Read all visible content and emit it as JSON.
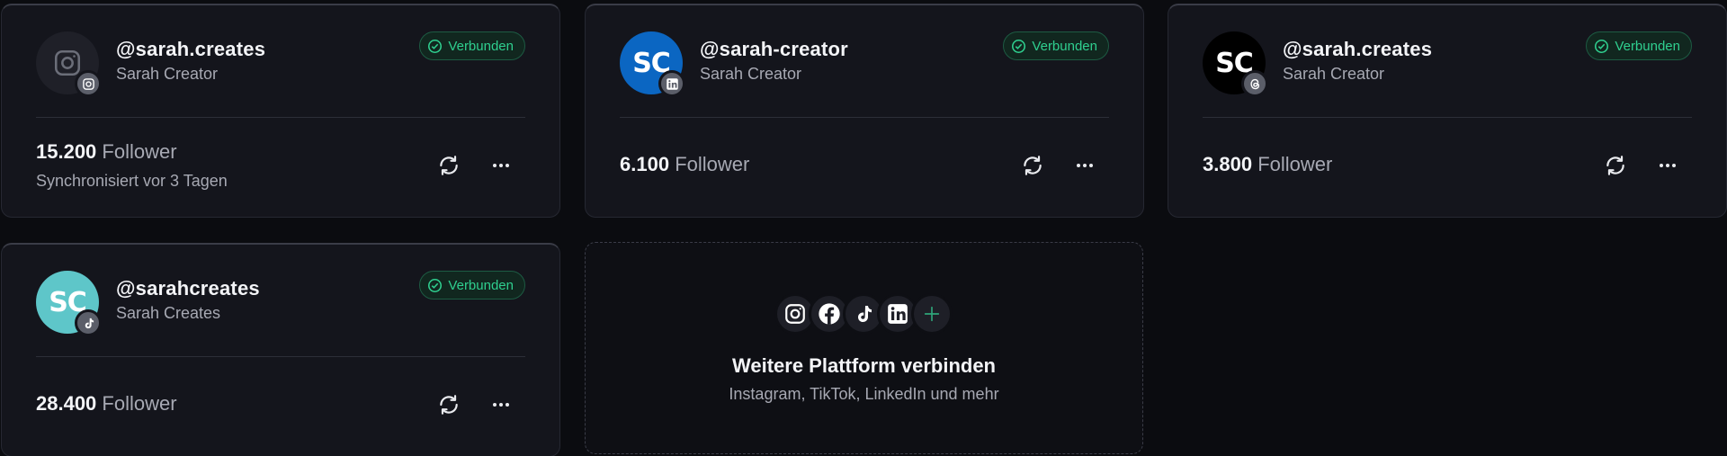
{
  "accounts": [
    {
      "handle": "@sarah.creates",
      "name": "Sarah Creator",
      "status": "Verbunden",
      "followers": "15.200",
      "followers_label": "Follower",
      "sync": "Synchronisiert vor 3 Tagen",
      "platform_icon": "instagram-icon",
      "avatar_text": "",
      "avatar_color": "#1f2028"
    },
    {
      "handle": "@sarah-creator",
      "name": "Sarah Creator",
      "status": "Verbunden",
      "followers": "6.100",
      "followers_label": "Follower",
      "platform_icon": "linkedin-icon",
      "avatar_text": "SC",
      "avatar_color": "#0b66c2"
    },
    {
      "handle": "@sarah.creates",
      "name": "Sarah Creator",
      "status": "Verbunden",
      "followers": "3.800",
      "followers_label": "Follower",
      "platform_icon": "threads-icon",
      "avatar_text": "SC",
      "avatar_color": "#000000"
    },
    {
      "handle": "@sarahcreates",
      "name": "Sarah Creates",
      "status": "Verbunden",
      "followers": "28.400",
      "followers_label": "Follower",
      "platform_icon": "tiktok-icon",
      "avatar_text": "SC",
      "avatar_color": "#5ec6c9"
    }
  ],
  "add_platform": {
    "title": "Weitere Plattform verbinden",
    "subtitle": "Instagram, TikTok, LinkedIn und mehr",
    "icons": [
      "instagram-icon",
      "facebook-icon",
      "tiktok-icon",
      "linkedin-icon",
      "plus-icon"
    ]
  },
  "colors": {
    "status_green": "#2fcf8f",
    "card_bg": "#14151c",
    "page_bg": "#0b0c10"
  }
}
